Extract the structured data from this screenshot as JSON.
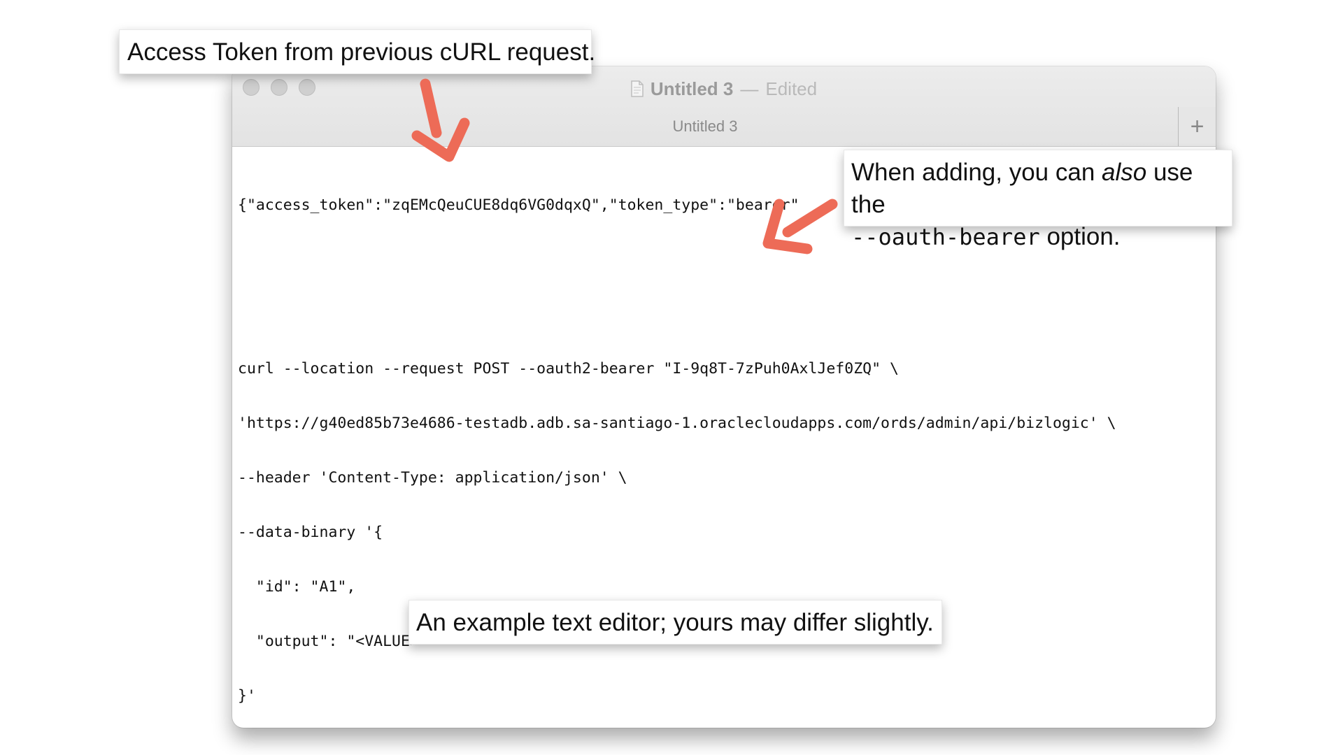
{
  "window": {
    "title": "Untitled 3",
    "title_separator": "—",
    "title_state": "Edited",
    "tab_label": "Untitled 3",
    "new_tab_symbol": "+"
  },
  "editor": {
    "token_line": "{\"access_token\":\"zqEMcQeuCUE8dq6VG0dqxQ\",\"token_type\":\"bearer\"",
    "curl_lines": [
      "curl --location --request POST --oauth2-bearer \"I-9q8T-7zPuh0AxlJef0ZQ\" \\",
      "'https://g40ed85b73e4686-testadb.adb.sa-santiago-1.oraclecloudapps.com/ords/admin/api/bizlogic' \\",
      "--header 'Content-Type: application/json' \\",
      "--data-binary '{",
      "  \"id\": \"A1\",",
      "  \"output\": \"<VALUE>\"",
      "}'"
    ]
  },
  "callouts": {
    "token_source": "Access Token from previous cURL request.",
    "bearer_part1": "When adding, you can ",
    "bearer_emph": "also",
    "bearer_part2": " use the",
    "bearer_option": "--oauth-bearer",
    "bearer_part3": " option.",
    "editor_note": "An example text editor; yours may differ slightly."
  },
  "colors": {
    "arrow": "#ed6b57",
    "titlebar": "#e6e6e6"
  },
  "icons": {
    "arrow": "arrow-icon",
    "document": "document-icon",
    "plus": "plus-icon"
  }
}
